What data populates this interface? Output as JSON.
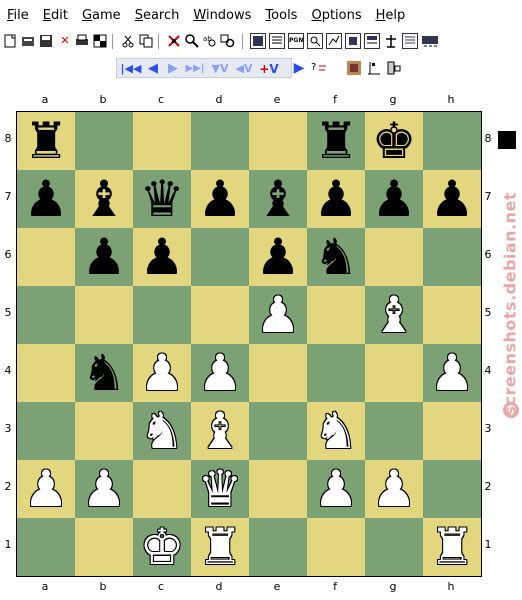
{
  "menu": [
    {
      "pre": "",
      "u": "F",
      "post": "ile"
    },
    {
      "pre": "",
      "u": "E",
      "post": "dit"
    },
    {
      "pre": "",
      "u": "G",
      "post": "ame"
    },
    {
      "pre": "",
      "u": "S",
      "post": "earch"
    },
    {
      "pre": "",
      "u": "W",
      "post": "indows"
    },
    {
      "pre": "",
      "u": "T",
      "post": "ools"
    },
    {
      "pre": "",
      "u": "O",
      "post": "ptions"
    },
    {
      "pre": "",
      "u": "H",
      "post": "elp"
    }
  ],
  "toolbar_icons": {
    "doc_label": "PGN"
  },
  "navigation": {
    "first": "|◀◀",
    "back": "◀",
    "forward": "▶",
    "last": "▶▶|",
    "var_down": "▼V",
    "var_up": "◀V",
    "var_add": "+V",
    "vflags": "V"
  },
  "board": {
    "files": [
      "a",
      "b",
      "c",
      "d",
      "e",
      "f",
      "g",
      "h"
    ],
    "ranks": [
      "8",
      "7",
      "6",
      "5",
      "4",
      "3",
      "2",
      "1"
    ],
    "position": [
      [
        "r",
        "",
        "",
        "",
        "",
        "r",
        "k",
        ""
      ],
      [
        "p",
        "b",
        "q",
        "p",
        "b",
        "p",
        "p",
        "p"
      ],
      [
        "",
        "p",
        "p",
        "",
        "p",
        "n",
        "",
        ""
      ],
      [
        "",
        "",
        "",
        "",
        "P",
        "",
        "B",
        ""
      ],
      [
        "",
        "n",
        "P",
        "P",
        "",
        "",
        "",
        "P"
      ],
      [
        "",
        "",
        "N",
        "B",
        "",
        "N",
        "",
        ""
      ],
      [
        "P",
        "P",
        "",
        "Q",
        "",
        "P",
        "P",
        ""
      ],
      [
        "",
        "",
        "K",
        "R",
        "",
        "",
        "",
        "R"
      ]
    ],
    "side_to_move": "black"
  },
  "colors": {
    "light_square": "#e2d77e",
    "dark_square": "#7ba174",
    "nav_accent": "#2a4ee8",
    "watermark": "#e8a7a7"
  },
  "watermark": "screenshots.debian.net"
}
